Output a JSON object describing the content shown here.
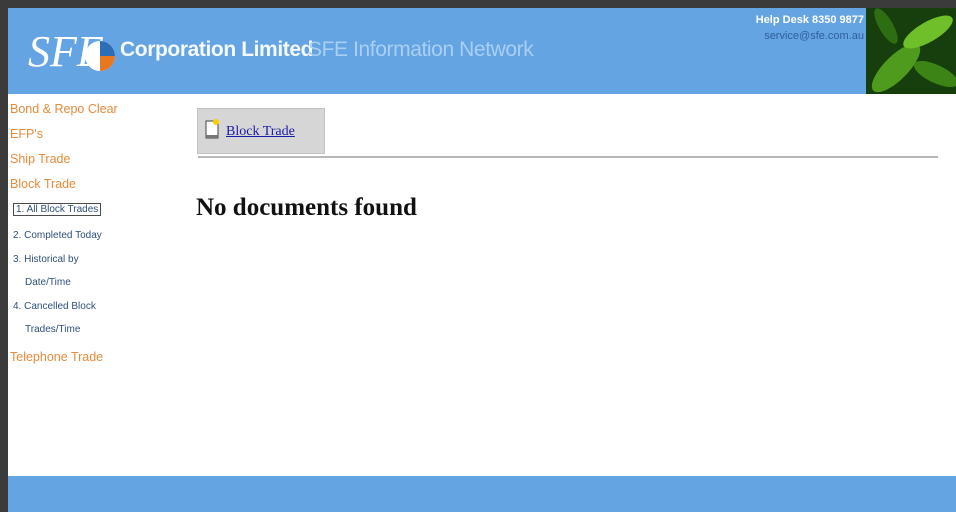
{
  "header": {
    "company": "Corporation Limited",
    "network": "SFE Information Network",
    "help_desk": "Help Desk 8350 9877",
    "email": "service@sfe.com.au"
  },
  "sidebar": {
    "items": [
      {
        "label": "Bond & Repo Clear"
      },
      {
        "label": "EFP's"
      },
      {
        "label": "Ship Trade"
      },
      {
        "label": "Block Trade"
      },
      {
        "label": "Telephone Trade"
      }
    ],
    "block_trade_sub": [
      {
        "label": "1. All Block Trades"
      },
      {
        "label": "2. Completed Today"
      },
      {
        "label": "3. Historical by"
      },
      {
        "label": "Date/Time"
      },
      {
        "label": "4. Cancelled Block"
      },
      {
        "label": "Trades/Time"
      }
    ]
  },
  "content": {
    "breadcrumb_label": "Block Trade",
    "message": "No documents found"
  },
  "colors": {
    "brand_blue": "#64a4e2",
    "nav_orange": "#ea8a3a",
    "link_blue": "#1a1aa8"
  }
}
